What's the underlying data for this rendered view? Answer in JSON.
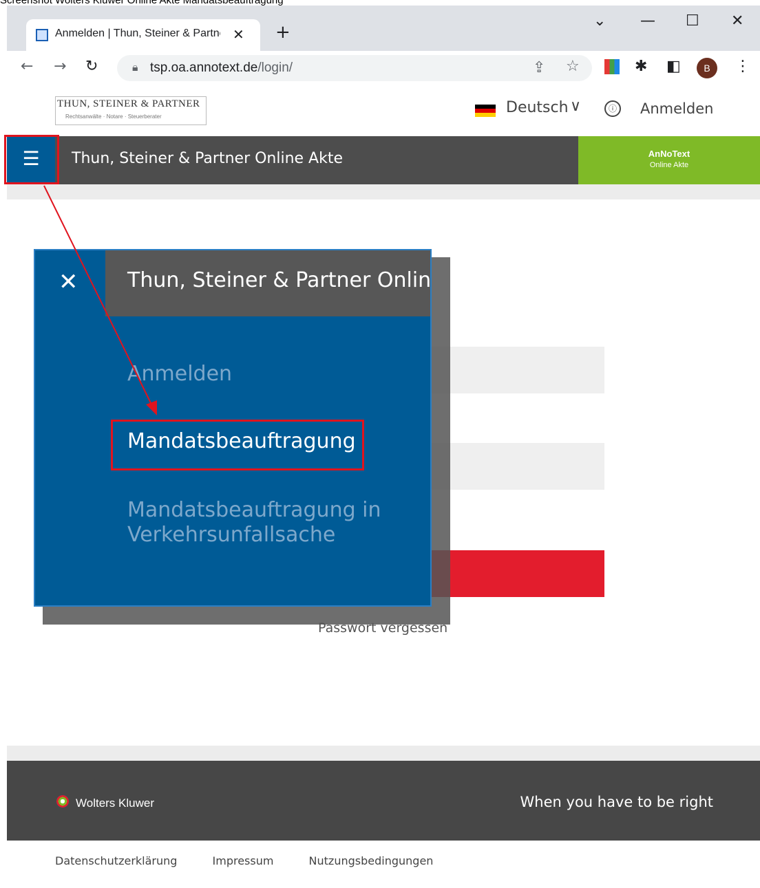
{
  "caption": "Screenshot Wolters Kluwer Online Akte Mandatsbeauftragung",
  "browser": {
    "tab_title": "Anmelden | Thun, Steiner & Partner",
    "url_host": "tsp.oa.annotext.de",
    "url_path": "/login/",
    "profile_initial": "B"
  },
  "header": {
    "logo_name": "THUN, STEINER & PARTNER",
    "logo_sub": "Rechtsanwälte · Notare · Steuerberater",
    "language": "Deutsch",
    "login_label": "Anmelden"
  },
  "navbar": {
    "title": "Thun, Steiner & Partner Online Akte",
    "brand_line1": "AnNoText",
    "brand_line2": "Online Akte"
  },
  "form": {
    "forgot_password": "Passwort vergessen"
  },
  "menu": {
    "title": "Thun, Steiner & Partner Online Akte",
    "items": [
      {
        "label": "Anmelden"
      },
      {
        "label": "Mandatsbeauftragung"
      },
      {
        "label": "Mandatsbeauftragung in"
      },
      {
        "label": "Verkehrsunfallsache"
      }
    ],
    "active_index": 1
  },
  "footer": {
    "company": "Wolters Kluwer",
    "tagline": "When you have to be right",
    "links": [
      "Datenschutzerklärung",
      "Impressum",
      "Nutzungsbedingungen"
    ]
  },
  "colors": {
    "primary_blue": "#005b96",
    "brand_green": "#7fba27",
    "accent_red": "#e31d2d",
    "highlight_red": "#e0141e"
  }
}
